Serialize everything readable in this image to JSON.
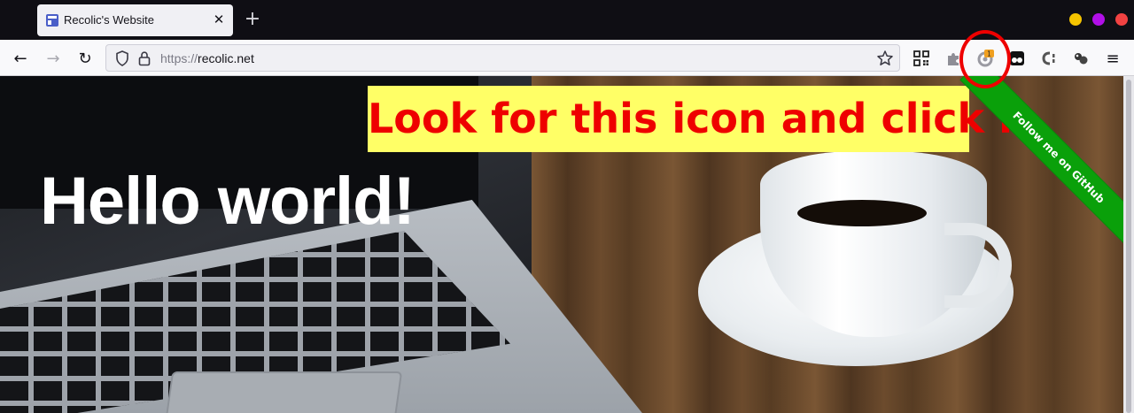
{
  "window": {
    "tab": {
      "title": "Recolic's Website",
      "close_glyph": "✕"
    },
    "new_tab_glyph": "+",
    "controls": {
      "minimize_color": "#f5c400",
      "maximize_color": "#b10fe8",
      "close_color": "#f24242"
    }
  },
  "navbar": {
    "back_glyph": "←",
    "forward_glyph": "→",
    "reload_glyph": "↻",
    "menu_glyph": "≡",
    "url_scheme": "https://",
    "url_host": "recolic.net",
    "extensions": [
      "qr-code-icon",
      "puzzle-icon",
      "addon-badge-icon",
      "tampermonkey-icon",
      "css-icon",
      "dots-icon"
    ],
    "badge_count": "1"
  },
  "page": {
    "heading": "Hello world!",
    "callout": "Look for this icon and click it",
    "ribbon": "Follow me on GitHub",
    "callout_colors": {
      "background": "#ffff66",
      "text": "#ee0000"
    },
    "ribbon_color": "#0aa00a"
  }
}
